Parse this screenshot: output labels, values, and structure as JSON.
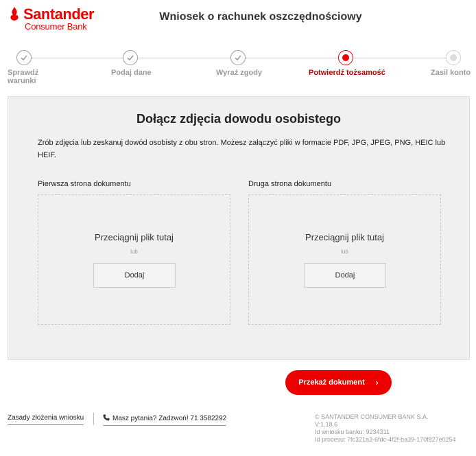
{
  "header": {
    "brand": "Santander",
    "brand_sub": "Consumer Bank",
    "title": "Wniosek o rachunek oszczędnościowy",
    "brand_color": "#ec0000"
  },
  "stepper": {
    "steps": [
      {
        "label_line1": "Sprawdź",
        "label_line2": "warunki",
        "state": "done"
      },
      {
        "label_line1": "Podaj dane",
        "label_line2": "",
        "state": "done"
      },
      {
        "label_line1": "Wyraź zgody",
        "label_line2": "",
        "state": "done"
      },
      {
        "label_line1": "Potwierdź tożsamość",
        "label_line2": "",
        "state": "active"
      },
      {
        "label_line1": "Zasil konto",
        "label_line2": "",
        "state": "pending"
      }
    ],
    "icons": {
      "done": "check-icon",
      "active": "dot-icon",
      "pending": "dot-icon"
    }
  },
  "main": {
    "title": "Dołącz zdjęcia dowodu osobistego",
    "description": "Zrób zdjęcia lub zeskanuj dowód osobisty z obu stron. Możesz załączyć pliki w formacie PDF, JPG, JPEG, PNG, HEIC lub HEIF.",
    "uploads": [
      {
        "label": "Pierwsza strona dokumentu",
        "drop_text": "Przeciągnij plik tutaj",
        "or_text": "lub",
        "button": "Dodaj"
      },
      {
        "label": "Druga strona dokumentu",
        "drop_text": "Przeciągnij plik tutaj",
        "or_text": "lub",
        "button": "Dodaj"
      }
    ],
    "submit": {
      "label": "Przekaż dokument",
      "icon": "chevron-right-icon"
    }
  },
  "footer": {
    "rules_link": "Zasady złożenia wniosku",
    "phone_link": "Masz pytania? Zadzwoń! 71 3582292",
    "phone_icon": "phone-icon",
    "legal": {
      "copyright": "© SANTANDER CONSUMER BANK S.A.",
      "version": "V:1.18.6",
      "bank_id": "Id wniosku banku: 9234311",
      "process_id": "Id procesu: 7fc321a3-6fdc-4f2f-ba39-170f827e0254"
    }
  }
}
